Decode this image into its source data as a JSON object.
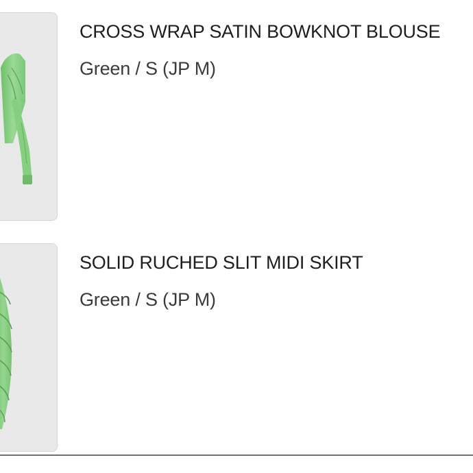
{
  "cart_items": [
    {
      "title": "CROSS WRAP SATIN BOWKNOT BLOUSE",
      "variant": "Green / S (JP M)",
      "image_subject": "green satin blouse"
    },
    {
      "title": "SOLID RUCHED SLIT MIDI SKIRT",
      "variant": "Green / S (JP M)",
      "image_subject": "green ruched midi skirt"
    }
  ],
  "colors": {
    "garment_green": "#8fd18a",
    "thumb_bg": "#e9e9e9"
  }
}
